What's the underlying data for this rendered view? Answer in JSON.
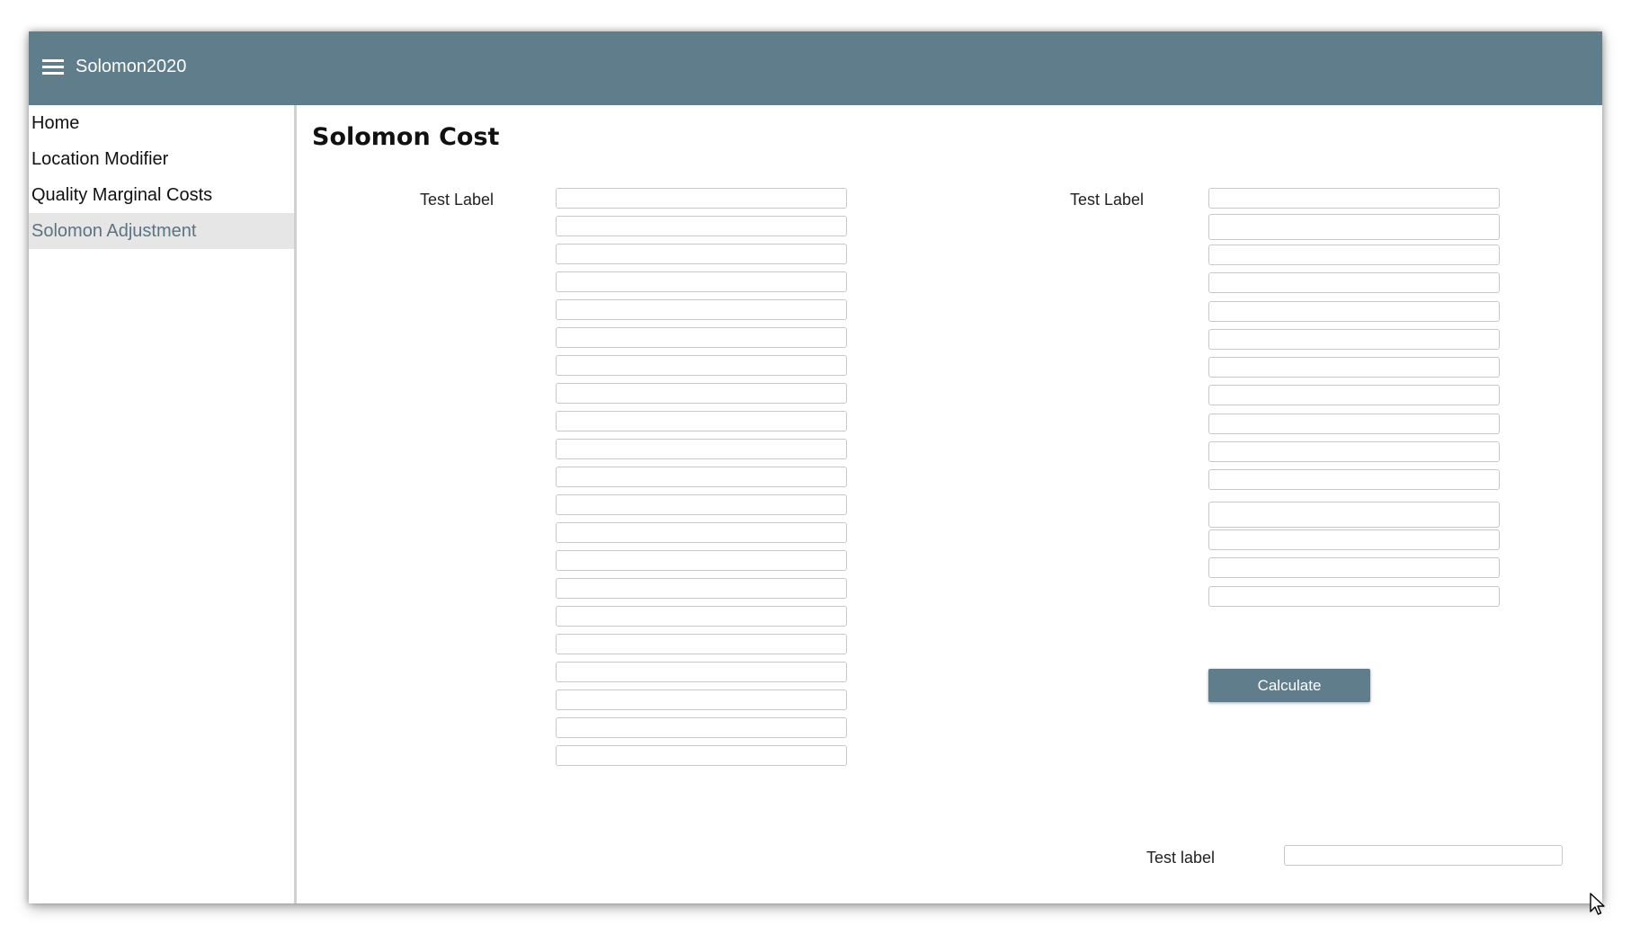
{
  "app": {
    "title": "Solomon2020"
  },
  "sidebar": {
    "items": [
      {
        "label": "Home",
        "active": false
      },
      {
        "label": "Location Modifier",
        "active": false
      },
      {
        "label": "Quality Marginal Costs",
        "active": false
      },
      {
        "label": "Solomon Adjustment",
        "active": true
      }
    ]
  },
  "main": {
    "title": "Solomon Cost",
    "left_group": {
      "label": "Test Label",
      "field_values": [
        "",
        "",
        "",
        "",
        "",
        "",
        "",
        "",
        "",
        "",
        "",
        "",
        "",
        "",
        "",
        "",
        "",
        "",
        "",
        "",
        ""
      ]
    },
    "right_group": {
      "label": "Test Label",
      "field_values": [
        "",
        "",
        "",
        "",
        "",
        "",
        "",
        "",
        "",
        "",
        "",
        "",
        "",
        "",
        "",
        ""
      ]
    },
    "calculate_label": "Calculate",
    "result": {
      "label": "Test label",
      "value": ""
    }
  },
  "colors": {
    "accent": "#607d8b",
    "active_nav_bg": "#e6e6e6",
    "active_nav_text": "#5a7482"
  }
}
